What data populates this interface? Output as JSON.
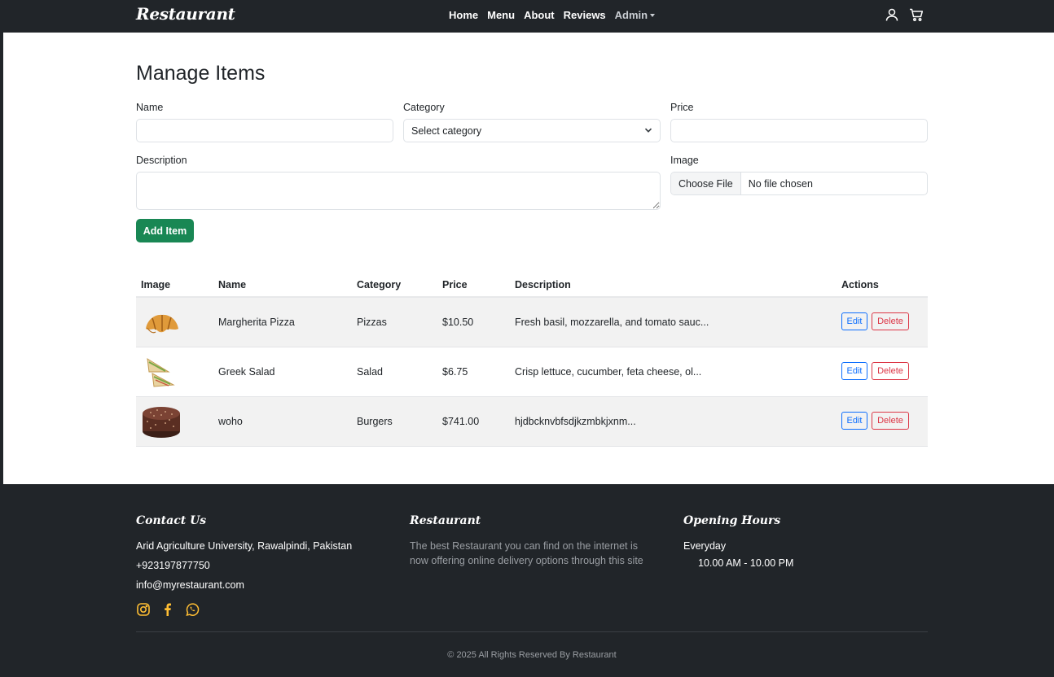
{
  "navbar": {
    "brand": "Restaurant",
    "links": [
      "Home",
      "Menu",
      "About",
      "Reviews"
    ],
    "admin_label": "Admin"
  },
  "page_title": "Manage Items",
  "form": {
    "name_label": "Name",
    "name_value": "",
    "category_label": "Category",
    "category_selected": "Select category",
    "price_label": "Price",
    "price_value": "",
    "description_label": "Description",
    "description_value": "",
    "image_label": "Image",
    "choose_file_label": "Choose File",
    "no_file_text": "No file chosen",
    "add_button": "Add Item"
  },
  "table": {
    "headers": [
      "Image",
      "Name",
      "Category",
      "Price",
      "Description",
      "Actions"
    ],
    "rows": [
      {
        "image": "croissant-image",
        "name": "Margherita Pizza",
        "category": "Pizzas",
        "price": "$10.50",
        "description": "Fresh basil, mozzarella, and tomato sauc...",
        "edit": "Edit",
        "delete": "Delete"
      },
      {
        "image": "sandwich-image",
        "name": "Greek Salad",
        "category": "Salad",
        "price": "$6.75",
        "description": "Crisp lettuce, cucumber, feta cheese, ol...",
        "edit": "Edit",
        "delete": "Delete"
      },
      {
        "image": "cake-image",
        "name": "woho",
        "category": "Burgers",
        "price": "$741.00",
        "description": "hjdbcknvbfsdjkzmbkjxnm...",
        "edit": "Edit",
        "delete": "Delete"
      }
    ]
  },
  "footer": {
    "contact_heading": "Contact Us",
    "address": "Arid Agriculture University, Rawalpindi, Pakistan",
    "phone": "+923197877750",
    "email": "info@myrestaurant.com",
    "about_heading": "Restaurant",
    "about_line1": "The best Restaurant you can find on the internet is",
    "about_line2": "now offering online delivery options through this site",
    "hours_heading": "Opening Hours",
    "hours_day": "Everyday",
    "hours_time": "10.00 AM - 10.00 PM",
    "copyright": "© 2025 All Rights Reserved By Restaurant",
    "socials": [
      "instagram-icon",
      "facebook-icon",
      "whatsapp-icon"
    ]
  },
  "colors": {
    "dark": "#212529",
    "success": "#198754",
    "primary": "#0d6efd",
    "danger": "#dc3545",
    "accent_yellow": "#ffbe33"
  }
}
